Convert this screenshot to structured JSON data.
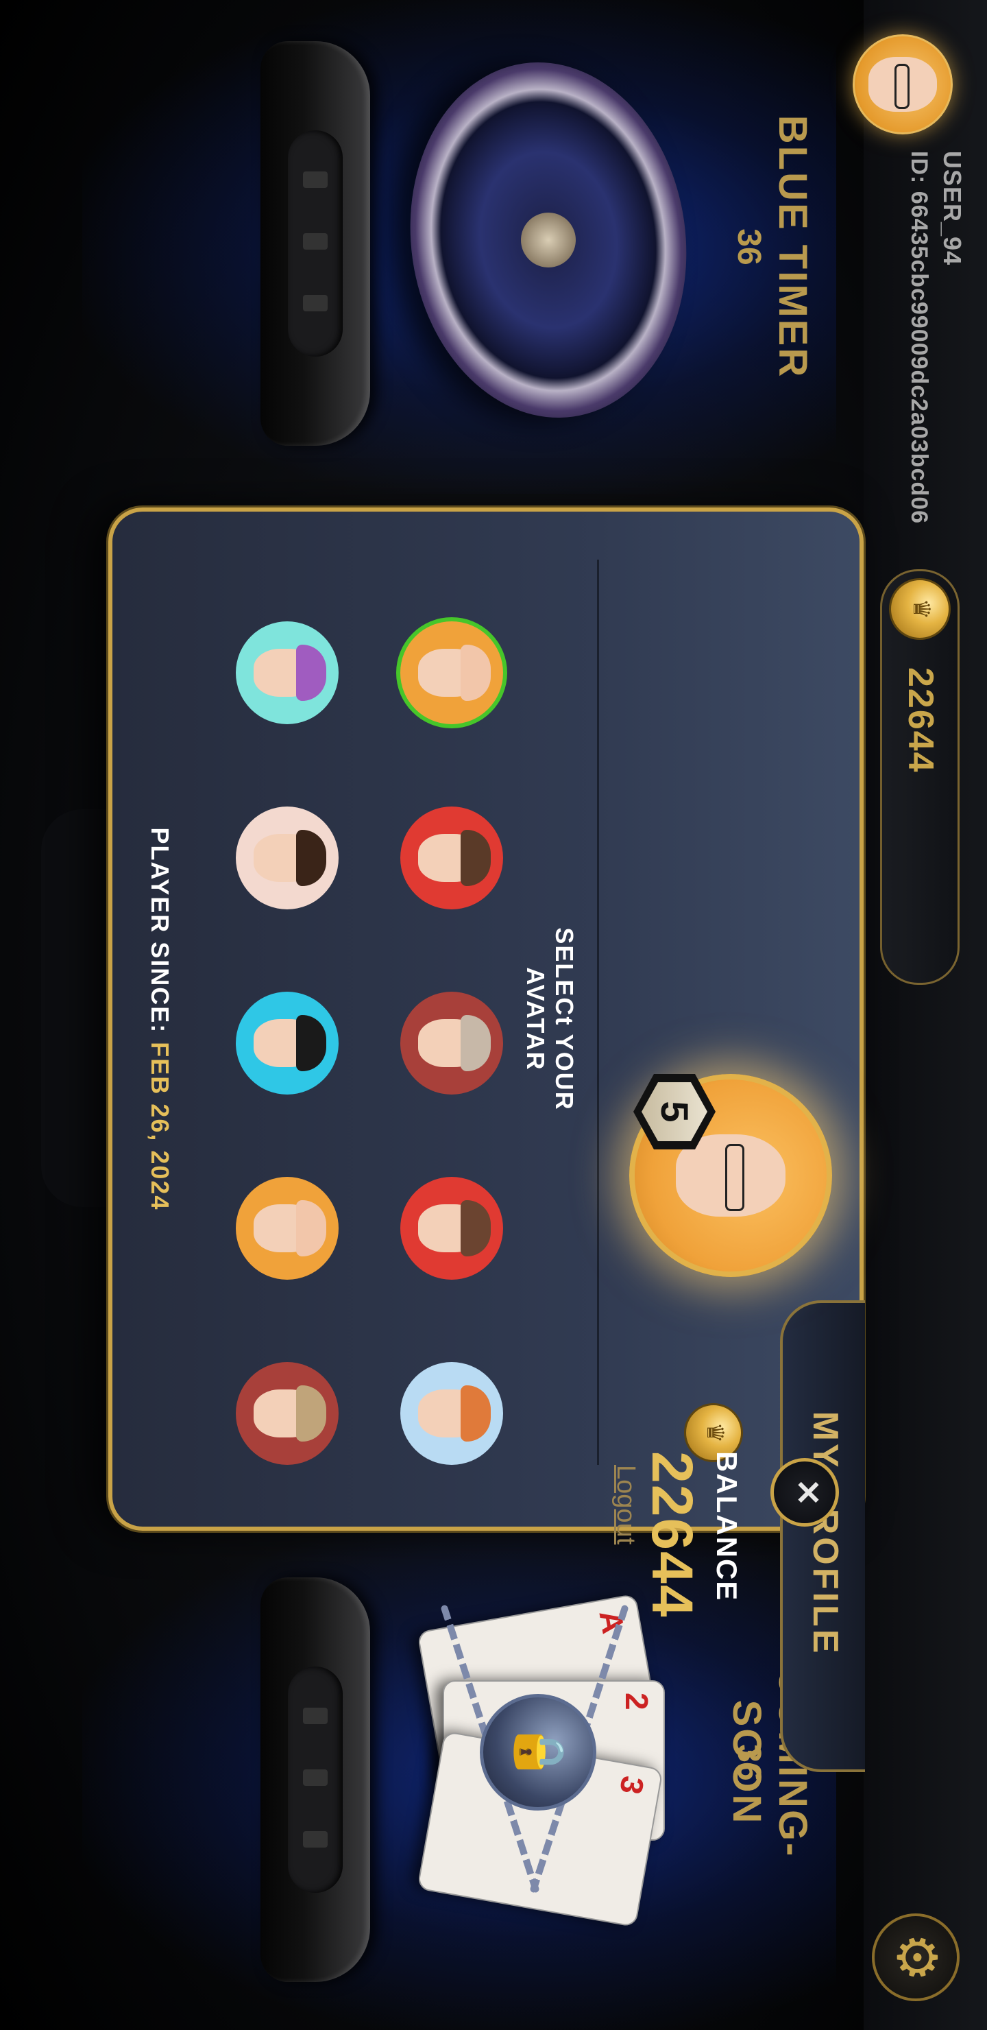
{
  "topbar": {
    "username": "USER_94",
    "user_id": "ID: 66435cbc99009dc2a03bcd06",
    "balance": "22644",
    "settings_icon": "gear-icon"
  },
  "games": [
    {
      "title": "BLUE TIMER",
      "count": "36",
      "icon": "roulette-wheel"
    },
    {
      "title": "COMING-SOON",
      "count": "36",
      "icon": "locked-cards"
    }
  ],
  "profile": {
    "title": "MY PROFILE",
    "level": "5",
    "balance_label": "BALANCE",
    "balance_value": "22644",
    "logout_label": "Logout",
    "select_avatar_label": "SELECt YOUR AVATAR",
    "player_since_label": "PLAYER SINCE:",
    "player_since_date": "FEB 26, 2024",
    "selected_avatar_index": 0
  },
  "avatars": [
    {
      "bg": "#f0a23a",
      "hair": "#f2c6aa"
    },
    {
      "bg": "#e03a32",
      "hair": "#5a3a28"
    },
    {
      "bg": "#a8403a",
      "hair": "#c7b8a8"
    },
    {
      "bg": "#e03a32",
      "hair": "#6b4430"
    },
    {
      "bg": "#b9dbf3",
      "hair": "#e07a3a"
    },
    {
      "bg": "#7fe4dc",
      "hair": "#a05cc0"
    },
    {
      "bg": "#f3d9cf",
      "hair": "#3a2418"
    },
    {
      "bg": "#2fc7e6",
      "hair": "#1a1a1a"
    },
    {
      "bg": "#f0a23a",
      "hair": "#f2c6aa"
    },
    {
      "bg": "#a8403a",
      "hair": "#c0a47a"
    }
  ],
  "colors": {
    "gold": "#c9a347",
    "accent_text": "#e6c05a",
    "selected_ring": "#46c62a"
  }
}
